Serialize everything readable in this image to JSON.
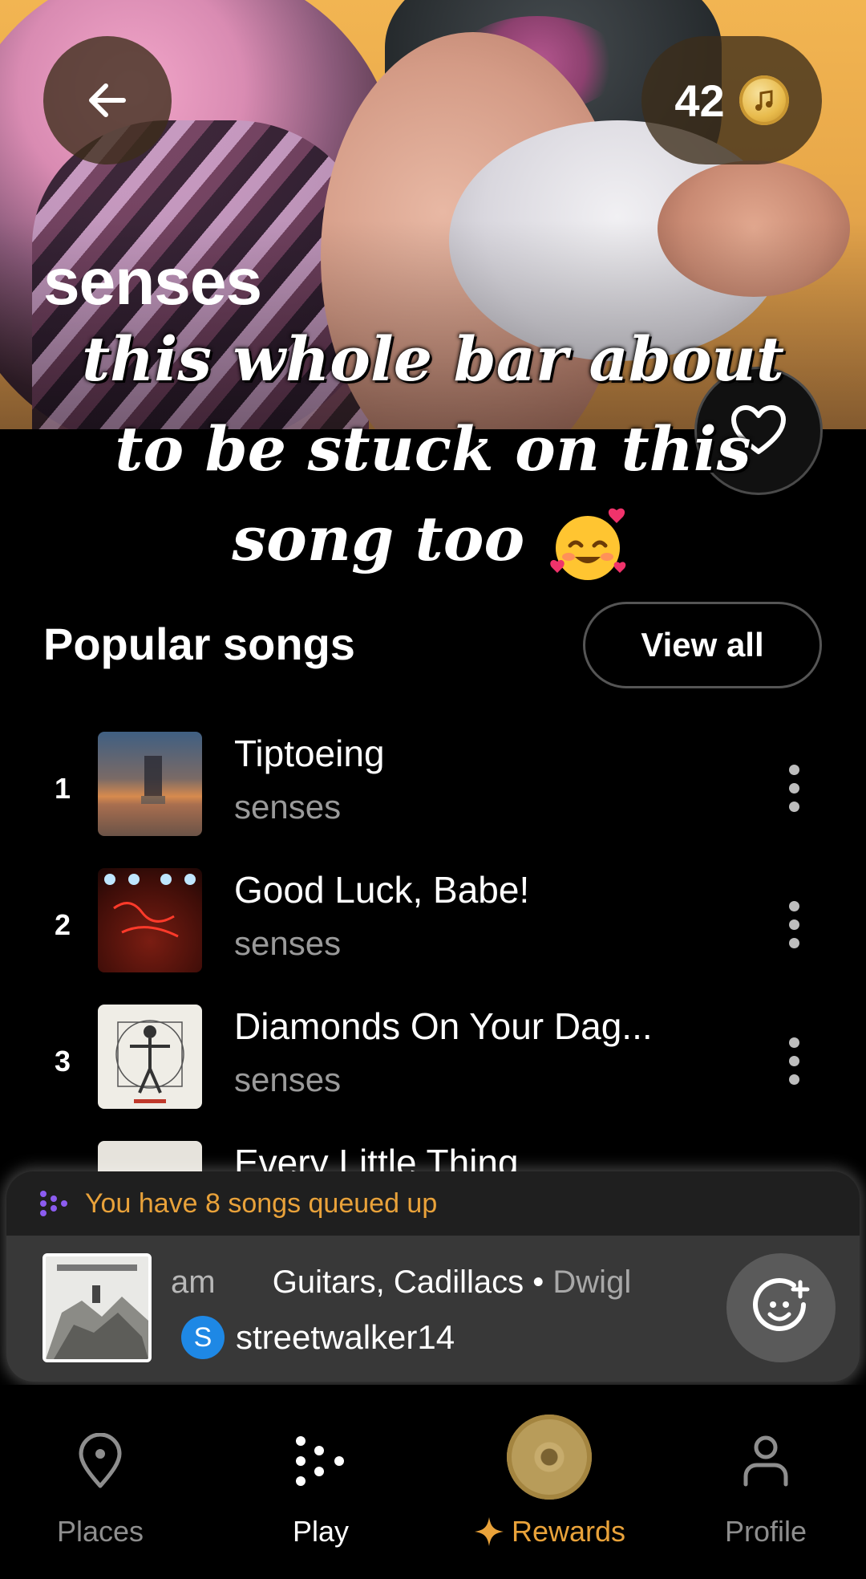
{
  "header": {
    "coins": "42",
    "artist": "senses"
  },
  "overlay_caption": {
    "line1": "this whole bar about",
    "line2": "to be stuck on this",
    "line3": "song too"
  },
  "popular": {
    "title": "Popular songs",
    "view_all": "View all",
    "songs": [
      {
        "rank": "1",
        "title": "Tiptoeing",
        "artist": "senses"
      },
      {
        "rank": "2",
        "title": "Good Luck, Babe!",
        "artist": "senses"
      },
      {
        "rank": "3",
        "title": "Diamonds On Your Dag...",
        "artist": "senses"
      },
      {
        "rank": "",
        "title": "Every Little Thing",
        "artist": ""
      }
    ]
  },
  "queue": {
    "message": "You have 8 songs queued up",
    "prev_fragment": "am",
    "song": "Guitars, Cadillacs",
    "separator": "•",
    "artist": "Dwigl",
    "user_initial": "S",
    "user": "streetwalker14"
  },
  "nav": {
    "places": "Places",
    "play": "Play",
    "rewards": "Rewards",
    "profile": "Profile"
  },
  "colors": {
    "accent_orange": "#e9a23a",
    "muted_text": "#9a9a9a",
    "avatar_blue": "#1e88e5",
    "queue_icon_purple": "#8c5cf0"
  }
}
